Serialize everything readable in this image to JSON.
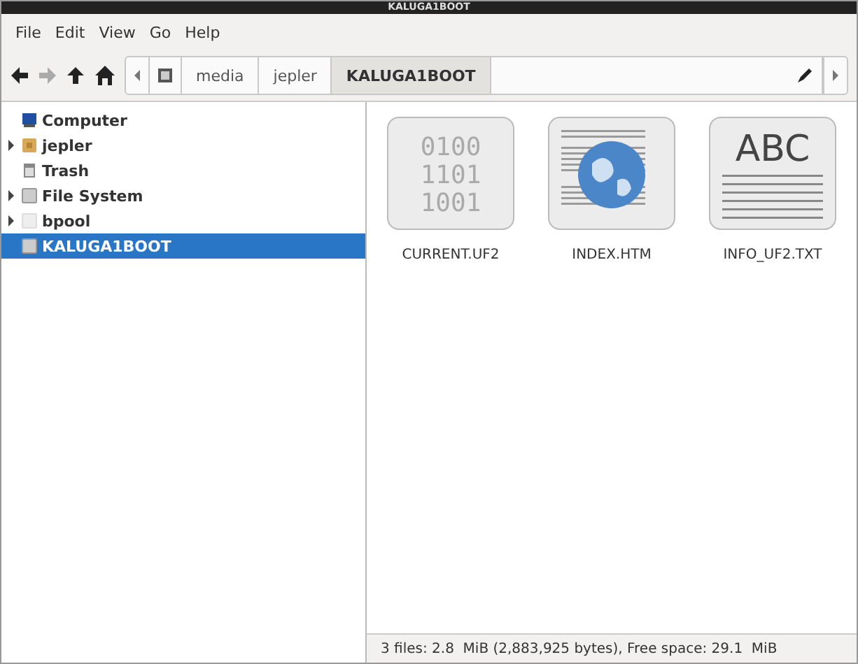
{
  "window": {
    "title": "KALUGA1BOOT"
  },
  "menu": [
    "File",
    "Edit",
    "View",
    "Go",
    "Help"
  ],
  "path": [
    {
      "label": "media",
      "selected": false
    },
    {
      "label": "jepler",
      "selected": false
    },
    {
      "label": "KALUGA1BOOT",
      "selected": true
    }
  ],
  "sidebar": {
    "items": [
      {
        "label": "Computer",
        "kind": "computer",
        "expander": false,
        "selected": false
      },
      {
        "label": "jepler",
        "kind": "home",
        "expander": true,
        "selected": false
      },
      {
        "label": "Trash",
        "kind": "trash",
        "expander": false,
        "selected": false
      },
      {
        "label": "File System",
        "kind": "drive",
        "expander": true,
        "selected": false
      },
      {
        "label": "bpool",
        "kind": "blank",
        "expander": true,
        "selected": false
      },
      {
        "label": "KALUGA1BOOT",
        "kind": "drive",
        "expander": false,
        "selected": true
      }
    ]
  },
  "files": [
    {
      "name": "CURRENT.UF2",
      "kind": "binary",
      "icon_text": [
        "0100",
        "1101",
        "1001"
      ]
    },
    {
      "name": "INDEX.HTM",
      "kind": "html"
    },
    {
      "name": "INFO_UF2.TXT",
      "kind": "text",
      "icon_text": [
        "ABC"
      ]
    }
  ],
  "status_bar": "3 files: 2.8  MiB (2,883,925 bytes), Free space: 29.1  MiB"
}
